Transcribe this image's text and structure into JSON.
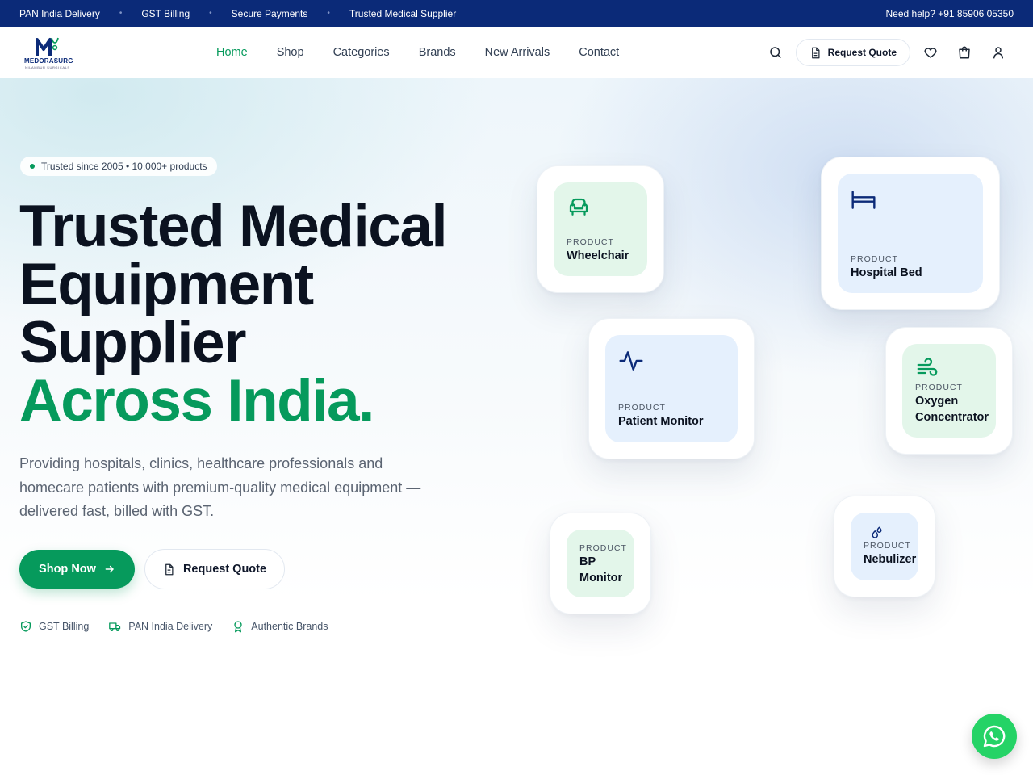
{
  "topbar": {
    "items": [
      "PAN India Delivery",
      "GST Billing",
      "Secure Payments",
      "Trusted Medical Supplier"
    ],
    "help": "Need help? +91 85906 05350"
  },
  "brand": {
    "name_a": "MEDORA",
    "name_b": "SURG",
    "tagline": "NILAMBUR SURGICALS"
  },
  "nav": {
    "items": [
      "Home",
      "Shop",
      "Categories",
      "Brands",
      "New Arrivals",
      "Contact"
    ],
    "active": "Home"
  },
  "header": {
    "quote_label": "Request Quote"
  },
  "hero": {
    "pill": "Trusted since 2005 • 10,000+ products",
    "title_lines": [
      "Trusted Medical",
      "Equipment",
      "Supplier"
    ],
    "title_accent": "Across India.",
    "lead": "Providing hospitals, clinics, healthcare professionals and homecare patients with premium-quality medical equipment — delivered fast, billed with GST.",
    "shop_label": "Shop Now",
    "quote_label": "Request Quote",
    "badges": [
      "GST Billing",
      "PAN India Delivery",
      "Authentic Brands"
    ]
  },
  "products": [
    {
      "label": "PRODUCT",
      "name": "Wheelchair",
      "icon": "armchair-icon",
      "tint": "green"
    },
    {
      "label": "PRODUCT",
      "name": "Hospital Bed",
      "icon": "bed-icon",
      "tint": "blue"
    },
    {
      "label": "PRODUCT",
      "name": "Patient Monitor",
      "icon": "activity-icon",
      "tint": "blue"
    },
    {
      "label": "PRODUCT",
      "name": "Oxygen Concentrator",
      "icon": "wind-icon",
      "tint": "green"
    },
    {
      "label": "PRODUCT",
      "name": "BP Monitor",
      "icon": "none",
      "tint": "green"
    },
    {
      "label": "PRODUCT",
      "name": "Nebulizer",
      "icon": "droplets-icon",
      "tint": "blue"
    }
  ],
  "colors": {
    "accent": "#069a5c",
    "brand_navy": "#0b2a78",
    "whatsapp": "#25d366"
  }
}
